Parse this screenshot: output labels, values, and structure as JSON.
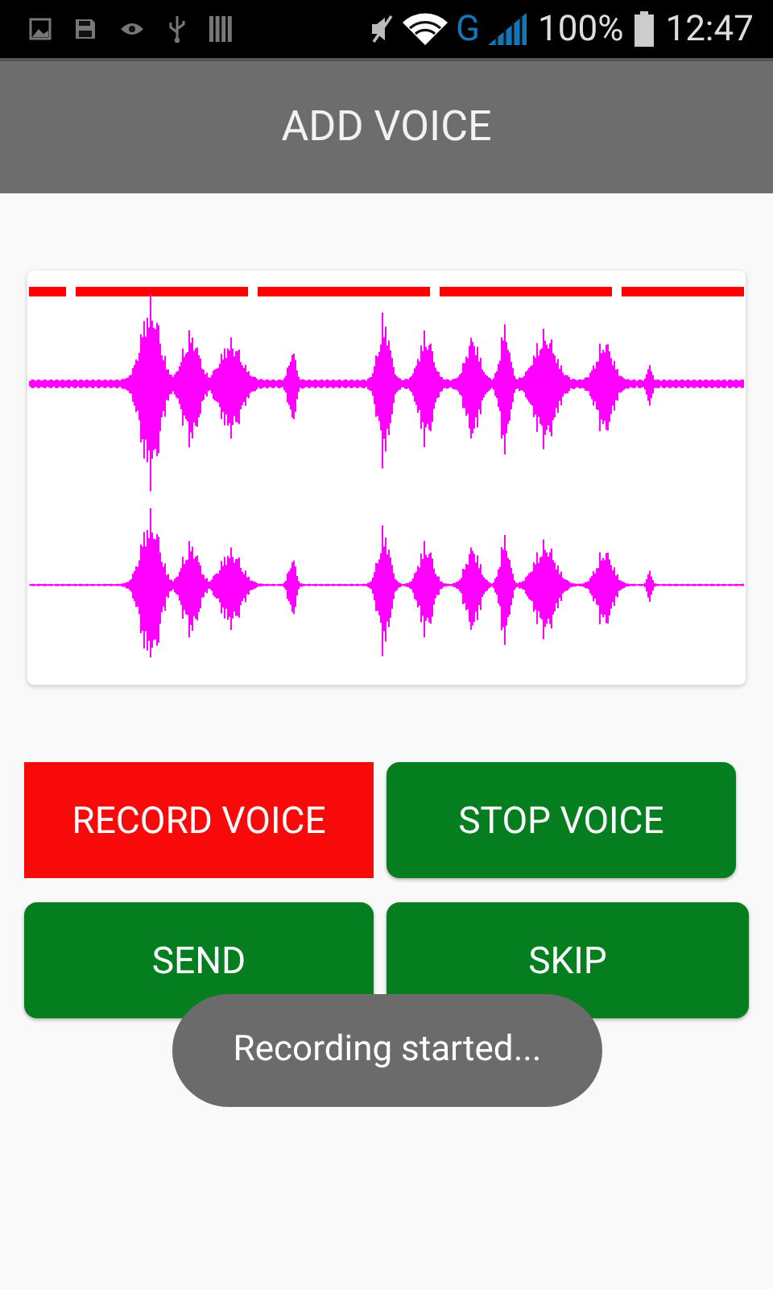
{
  "status_bar": {
    "network": "G",
    "battery": "100%",
    "time": "12:47"
  },
  "title": "ADD VOICE",
  "buttons": [
    {
      "label": "RECORD VOICE",
      "color": "#f80a0a"
    },
    {
      "label": "STOP VOICE",
      "color": "#047e1f"
    },
    {
      "label": "SEND",
      "color": "#047e1f"
    },
    {
      "label": "SKIP",
      "color": "#047e1f"
    }
  ],
  "toast": "Recording started..."
}
